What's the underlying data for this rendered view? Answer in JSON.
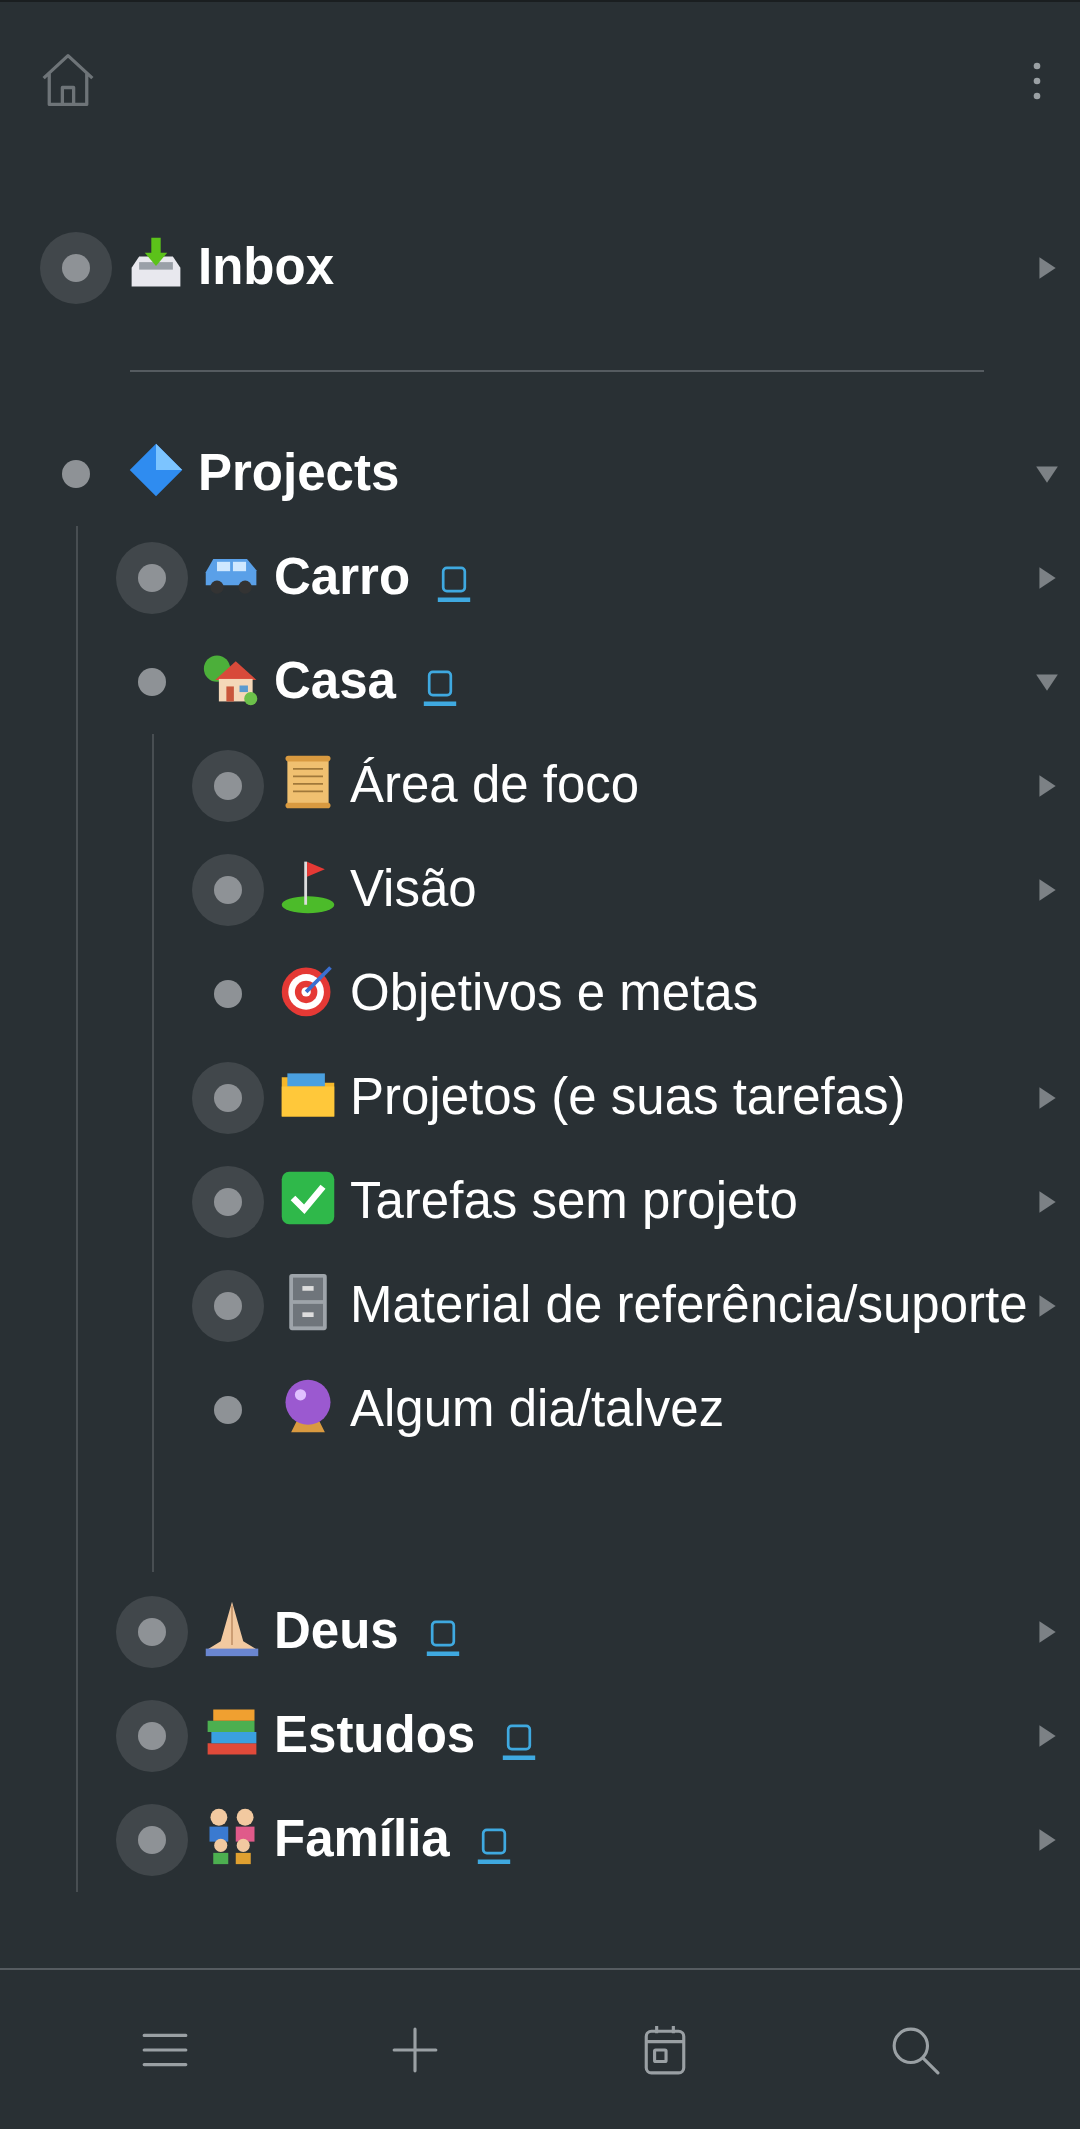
{
  "inbox": {
    "title": "Inbox",
    "kind": "parent",
    "expanded": false
  },
  "projects": {
    "title": "Projects",
    "kind": "parent",
    "expanded": true,
    "children": [
      {
        "title": "Carro",
        "kind": "parent",
        "expanded": false,
        "link": true
      },
      {
        "title": "Casa",
        "kind": "parent",
        "expanded": true,
        "link": true,
        "children": [
          {
            "title": "Área de foco",
            "kind": "parent",
            "expanded": false
          },
          {
            "title": "Visão",
            "kind": "parent",
            "expanded": false
          },
          {
            "title": "Objetivos e metas",
            "kind": "leaf"
          },
          {
            "title": "Projetos (e suas tarefas)",
            "kind": "parent",
            "expanded": false
          },
          {
            "title": "Tarefas sem projeto",
            "kind": "parent",
            "expanded": false
          },
          {
            "title": "Material de referência/suporte",
            "kind": "parent",
            "expanded": false
          },
          {
            "title": "Algum dia/talvez",
            "kind": "leaf"
          }
        ]
      },
      {
        "title": "Deus",
        "kind": "parent",
        "expanded": false,
        "link": true
      },
      {
        "title": "Estudos",
        "kind": "parent",
        "expanded": false,
        "link": true
      },
      {
        "title": "Família",
        "kind": "parent",
        "expanded": false,
        "link": true
      }
    ]
  }
}
